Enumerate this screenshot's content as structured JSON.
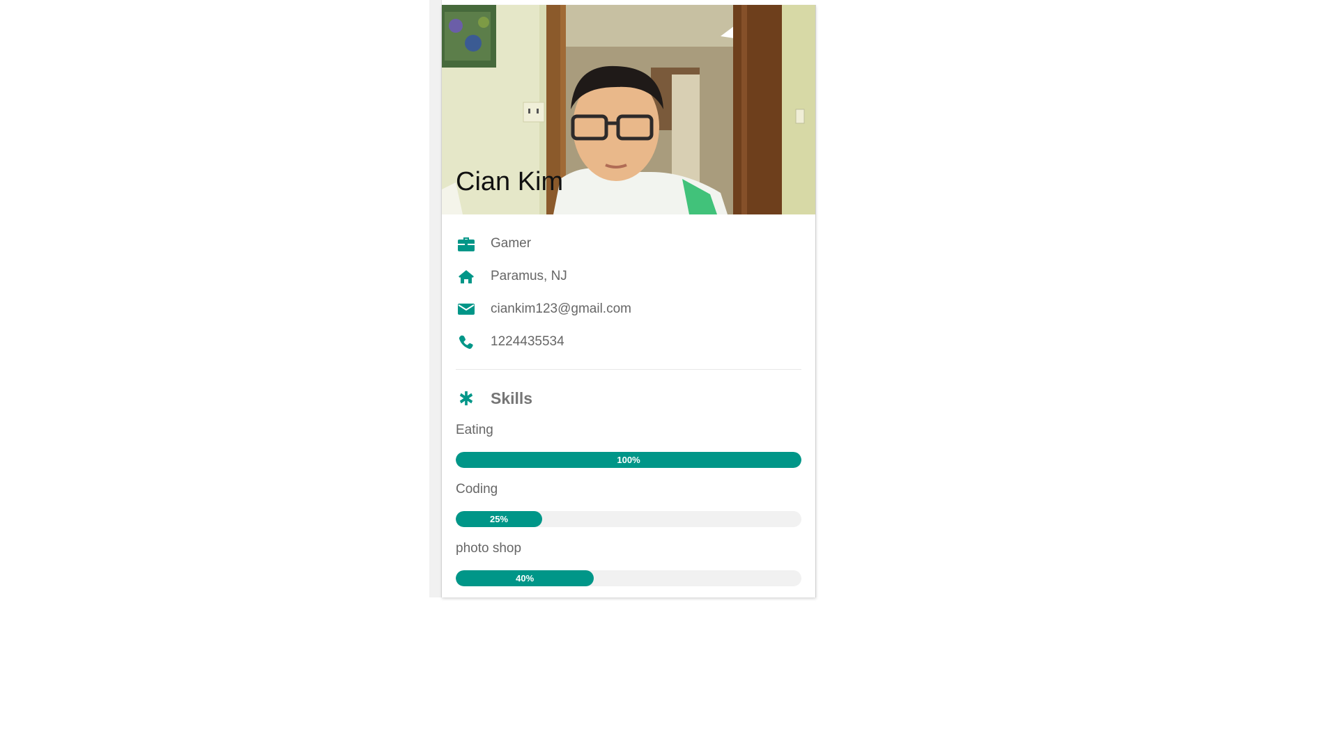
{
  "profile": {
    "name": "Cian Kim",
    "occupation": "Gamer",
    "location": "Paramus, NJ",
    "email": "ciankim123@gmail.com",
    "phone": "1224435534",
    "icons": [
      "briefcase-icon",
      "home-icon",
      "envelope-icon",
      "phone-icon"
    ]
  },
  "skills": {
    "heading": "Skills",
    "icon": "asterisk-icon",
    "items": [
      {
        "label": "Eating",
        "percent_label": "100%",
        "percent": 100
      },
      {
        "label": "Coding",
        "percent_label": "25%",
        "percent": 25
      },
      {
        "label": "photo shop",
        "percent_label": "40%",
        "percent": 40
      }
    ]
  },
  "colors": {
    "accent": "#009688",
    "text": "#666666",
    "track": "#f1f1f1"
  }
}
